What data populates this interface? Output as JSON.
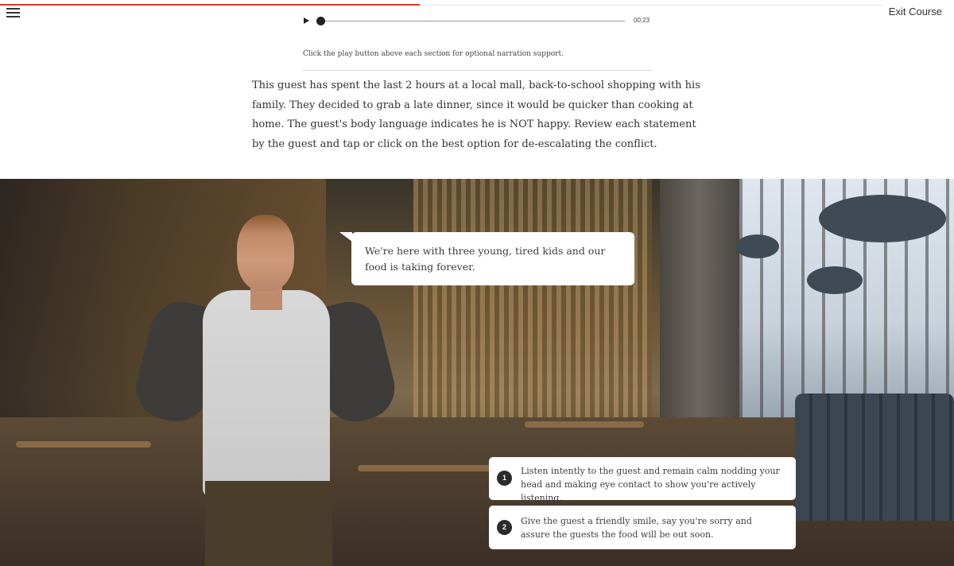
{
  "app": {
    "progress_fraction": 0.44,
    "menu_icon": "hamburger-menu-icon",
    "exit_label": "Exit Course"
  },
  "audio": {
    "play_icon": "play-icon",
    "time": "00:23",
    "played_fraction": 0.0
  },
  "narration_note": "Click the play button above each section for optional narration support.",
  "intro_text": "This guest has spent the last 2 hours at a local mall, back-to-school shopping with his family. They decided to grab a late dinner, since it would be quicker than cooking at home. The guest's body language indicates he is NOT happy. Review each statement by the guest and tap or click on the best option for de-escalating the conflict.",
  "scene": {
    "guest_statement": "We're here with three young, tired kids and our food is taking forever.",
    "options": [
      {
        "number": "1",
        "text": "Listen intently to the guest and remain calm nodding your head and making eye contact to show you're actively listening."
      },
      {
        "number": "2",
        "text": "Give the guest a friendly smile, say you're sorry and assure the guests the food will be out soon."
      }
    ]
  },
  "colors": {
    "accent": "#d9362b",
    "text": "#333333",
    "option_badge": "#2b2b2b"
  }
}
